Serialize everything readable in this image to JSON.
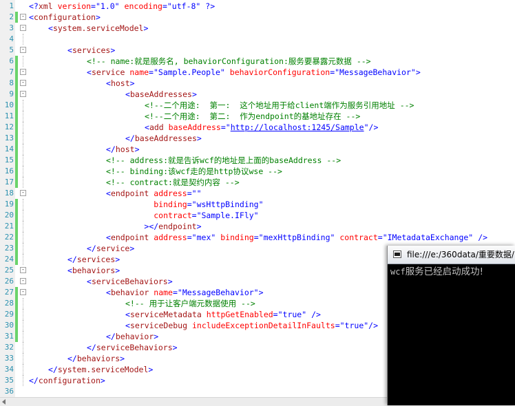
{
  "editor": {
    "colors": {
      "punct": "#0000ff",
      "tag": "#a31515",
      "attr": "#ff0000",
      "value": "#0000ff",
      "comment": "#008000",
      "line_number": "#2b91af",
      "changed_bar": "#6ad36a"
    },
    "lines": [
      {
        "n": "1",
        "indent": 0,
        "fold": "",
        "mark": false,
        "tokens": [
          [
            "p",
            "<?"
          ],
          [
            "t",
            "xml"
          ],
          [
            "s",
            " "
          ],
          [
            "a",
            "version"
          ],
          [
            "p",
            "="
          ],
          [
            "v",
            "\"1.0\""
          ],
          [
            "s",
            " "
          ],
          [
            "a",
            "encoding"
          ],
          [
            "p",
            "="
          ],
          [
            "v",
            "\"utf-8\""
          ],
          [
            "s",
            " "
          ],
          [
            "p",
            "?>"
          ]
        ]
      },
      {
        "n": "2",
        "indent": 0,
        "fold": "-",
        "mark": true,
        "tokens": [
          [
            "p",
            "<"
          ],
          [
            "t",
            "configuration"
          ],
          [
            "p",
            ">"
          ]
        ]
      },
      {
        "n": "3",
        "indent": 1,
        "fold": "-",
        "mark": false,
        "tokens": [
          [
            "p",
            "<"
          ],
          [
            "t",
            "system.serviceModel"
          ],
          [
            "p",
            ">"
          ]
        ]
      },
      {
        "n": "4",
        "indent": 2,
        "fold": "",
        "mark": false,
        "tokens": []
      },
      {
        "n": "5",
        "indent": 2,
        "fold": "-",
        "mark": false,
        "tokens": [
          [
            "p",
            "<"
          ],
          [
            "t",
            "services"
          ],
          [
            "p",
            ">"
          ]
        ]
      },
      {
        "n": "6",
        "indent": 3,
        "fold": "",
        "mark": true,
        "tokens": [
          [
            "c",
            "<!-- name:就是服务名, behaviorConfiguration:服务要暴露元数据 -->"
          ]
        ]
      },
      {
        "n": "7",
        "indent": 3,
        "fold": "-",
        "mark": true,
        "tokens": [
          [
            "p",
            "<"
          ],
          [
            "t",
            "service"
          ],
          [
            "s",
            " "
          ],
          [
            "a",
            "name"
          ],
          [
            "p",
            "="
          ],
          [
            "v",
            "\"Sample.People\""
          ],
          [
            "s",
            " "
          ],
          [
            "a",
            "behaviorConfiguration"
          ],
          [
            "p",
            "="
          ],
          [
            "v",
            "\"MessageBehavior\""
          ],
          [
            "p",
            ">"
          ]
        ]
      },
      {
        "n": "8",
        "indent": 4,
        "fold": "-",
        "mark": true,
        "tokens": [
          [
            "p",
            "<"
          ],
          [
            "t",
            "host"
          ],
          [
            "p",
            ">"
          ]
        ]
      },
      {
        "n": "9",
        "indent": 5,
        "fold": "-",
        "mark": true,
        "tokens": [
          [
            "p",
            "<"
          ],
          [
            "t",
            "baseAddresses"
          ],
          [
            "p",
            ">"
          ]
        ]
      },
      {
        "n": "10",
        "indent": 6,
        "fold": "",
        "mark": true,
        "tokens": [
          [
            "c",
            "<!--二个用途:  第一:  这个地址用于给client端作为服务引用地址 -->"
          ]
        ]
      },
      {
        "n": "11",
        "indent": 6,
        "fold": "",
        "mark": true,
        "tokens": [
          [
            "c",
            "<!--二个用途:  第二:  作为endpoint的基地址存在 -->"
          ]
        ]
      },
      {
        "n": "12",
        "indent": 6,
        "fold": "",
        "mark": true,
        "tokens": [
          [
            "p",
            "<"
          ],
          [
            "t",
            "add"
          ],
          [
            "s",
            " "
          ],
          [
            "a",
            "baseAddress"
          ],
          [
            "p",
            "="
          ],
          [
            "v",
            "\""
          ],
          [
            "l",
            "http://localhost:1245/Sample"
          ],
          [
            "v",
            "\""
          ],
          [
            "p",
            "/>"
          ]
        ]
      },
      {
        "n": "13",
        "indent": 5,
        "fold": "",
        "mark": true,
        "tokens": [
          [
            "p",
            "</"
          ],
          [
            "t",
            "baseAddresses"
          ],
          [
            "p",
            ">"
          ]
        ]
      },
      {
        "n": "14",
        "indent": 4,
        "fold": "",
        "mark": true,
        "tokens": [
          [
            "p",
            "</"
          ],
          [
            "t",
            "host"
          ],
          [
            "p",
            ">"
          ]
        ]
      },
      {
        "n": "15",
        "indent": 4,
        "fold": "",
        "mark": true,
        "tokens": [
          [
            "c",
            "<!-- address:就是告诉wcf的地址是上面的baseAddress -->"
          ]
        ]
      },
      {
        "n": "16",
        "indent": 4,
        "fold": "",
        "mark": true,
        "tokens": [
          [
            "c",
            "<!-- binding:该wcf走的是http协议wse -->"
          ]
        ]
      },
      {
        "n": "17",
        "indent": 4,
        "fold": "",
        "mark": true,
        "tokens": [
          [
            "c",
            "<!-- contract:就是契约内容 -->"
          ]
        ]
      },
      {
        "n": "18",
        "indent": 4,
        "fold": "-",
        "mark": false,
        "tokens": [
          [
            "p",
            "<"
          ],
          [
            "t",
            "endpoint"
          ],
          [
            "s",
            " "
          ],
          [
            "a",
            "address"
          ],
          [
            "p",
            "="
          ],
          [
            "v",
            "\"\""
          ]
        ]
      },
      {
        "n": "19",
        "indent": 4,
        "fold": "",
        "mark": true,
        "tokens": [
          [
            "s",
            "          "
          ],
          [
            "a",
            "binding"
          ],
          [
            "p",
            "="
          ],
          [
            "v",
            "\"wsHttpBinding\""
          ]
        ]
      },
      {
        "n": "20",
        "indent": 4,
        "fold": "",
        "mark": true,
        "tokens": [
          [
            "s",
            "          "
          ],
          [
            "a",
            "contract"
          ],
          [
            "p",
            "="
          ],
          [
            "v",
            "\"Sample.IFly\""
          ]
        ]
      },
      {
        "n": "21",
        "indent": 4,
        "fold": "",
        "mark": true,
        "tokens": [
          [
            "s",
            "        "
          ],
          [
            "p",
            "></"
          ],
          [
            "t",
            "endpoint"
          ],
          [
            "p",
            ">"
          ]
        ]
      },
      {
        "n": "22",
        "indent": 4,
        "fold": "",
        "mark": true,
        "tokens": [
          [
            "p",
            "<"
          ],
          [
            "t",
            "endpoint"
          ],
          [
            "s",
            " "
          ],
          [
            "a",
            "address"
          ],
          [
            "p",
            "="
          ],
          [
            "v",
            "\"mex\""
          ],
          [
            "s",
            " "
          ],
          [
            "a",
            "binding"
          ],
          [
            "p",
            "="
          ],
          [
            "v",
            "\"mexHttpBinding\""
          ],
          [
            "s",
            " "
          ],
          [
            "a",
            "contract"
          ],
          [
            "p",
            "="
          ],
          [
            "v",
            "\"IMetadataExchange\""
          ],
          [
            "s",
            " "
          ],
          [
            "p",
            "/>"
          ]
        ]
      },
      {
        "n": "23",
        "indent": 3,
        "fold": "",
        "mark": true,
        "tokens": [
          [
            "p",
            "</"
          ],
          [
            "t",
            "service"
          ],
          [
            "p",
            ">"
          ]
        ]
      },
      {
        "n": "24",
        "indent": 2,
        "fold": "",
        "mark": true,
        "tokens": [
          [
            "p",
            "</"
          ],
          [
            "t",
            "services"
          ],
          [
            "p",
            ">"
          ]
        ]
      },
      {
        "n": "25",
        "indent": 2,
        "fold": "-",
        "mark": false,
        "tokens": [
          [
            "p",
            "<"
          ],
          [
            "t",
            "behaviors"
          ],
          [
            "p",
            ">"
          ]
        ]
      },
      {
        "n": "26",
        "indent": 3,
        "fold": "-",
        "mark": false,
        "tokens": [
          [
            "p",
            "<"
          ],
          [
            "t",
            "serviceBehaviors"
          ],
          [
            "p",
            ">"
          ]
        ]
      },
      {
        "n": "27",
        "indent": 4,
        "fold": "-",
        "mark": true,
        "tokens": [
          [
            "p",
            "<"
          ],
          [
            "t",
            "behavior"
          ],
          [
            "s",
            " "
          ],
          [
            "a",
            "name"
          ],
          [
            "p",
            "="
          ],
          [
            "v",
            "\"MessageBehavior\""
          ],
          [
            "p",
            ">"
          ]
        ]
      },
      {
        "n": "28",
        "indent": 5,
        "fold": "",
        "mark": true,
        "tokens": [
          [
            "c",
            "<!-- 用于让客户端元数据使用 -->"
          ]
        ]
      },
      {
        "n": "29",
        "indent": 5,
        "fold": "",
        "mark": true,
        "tokens": [
          [
            "p",
            "<"
          ],
          [
            "t",
            "serviceMetadata"
          ],
          [
            "s",
            " "
          ],
          [
            "a",
            "httpGetEnabled"
          ],
          [
            "p",
            "="
          ],
          [
            "v",
            "\"true\""
          ],
          [
            "s",
            " "
          ],
          [
            "p",
            "/>"
          ]
        ]
      },
      {
        "n": "30",
        "indent": 5,
        "fold": "",
        "mark": true,
        "tokens": [
          [
            "p",
            "<"
          ],
          [
            "t",
            "serviceDebug"
          ],
          [
            "s",
            " "
          ],
          [
            "a",
            "includeExceptionDetailInFaults"
          ],
          [
            "p",
            "="
          ],
          [
            "v",
            "\"true\""
          ],
          [
            "p",
            "/>"
          ]
        ]
      },
      {
        "n": "31",
        "indent": 4,
        "fold": "",
        "mark": true,
        "tokens": [
          [
            "p",
            "</"
          ],
          [
            "t",
            "behavior"
          ],
          [
            "p",
            ">"
          ]
        ]
      },
      {
        "n": "32",
        "indent": 3,
        "fold": "",
        "mark": false,
        "tokens": [
          [
            "p",
            "</"
          ],
          [
            "t",
            "serviceBehaviors"
          ],
          [
            "p",
            ">"
          ]
        ]
      },
      {
        "n": "33",
        "indent": 2,
        "fold": "",
        "mark": false,
        "tokens": [
          [
            "p",
            "</"
          ],
          [
            "t",
            "behaviors"
          ],
          [
            "p",
            ">"
          ]
        ]
      },
      {
        "n": "34",
        "indent": 1,
        "fold": "",
        "mark": false,
        "tokens": [
          [
            "p",
            "</"
          ],
          [
            "t",
            "system.serviceModel"
          ],
          [
            "p",
            ">"
          ]
        ]
      },
      {
        "n": "35",
        "indent": 0,
        "fold": "",
        "mark": false,
        "tokens": [
          [
            "p",
            "</"
          ],
          [
            "t",
            "configuration"
          ],
          [
            "p",
            ">"
          ]
        ]
      },
      {
        "n": "36",
        "indent": 0,
        "fold": "",
        "mark": false,
        "tokens": []
      }
    ]
  },
  "console": {
    "title": "file:///e:/360data/重要数据/",
    "prefix": "wcf",
    "message": "服务已经启动成功!"
  }
}
